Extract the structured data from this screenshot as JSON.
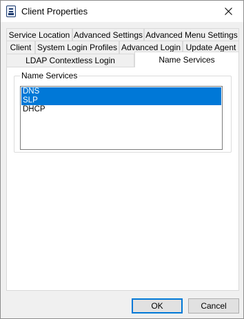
{
  "window": {
    "title": "Client Properties",
    "close_icon": "close-icon",
    "app_icon": "client-properties-icon"
  },
  "tabs": {
    "row1": [
      "Service Location",
      "Advanced Settings",
      "Advanced Menu Settings"
    ],
    "row2": [
      "Client",
      "System Login Profiles",
      "Advanced Login",
      "Update Agent"
    ],
    "row3": [
      "LDAP Contextless Login",
      "Name Services"
    ],
    "selected": "Name Services"
  },
  "name_services": {
    "group_label": "Name Services",
    "items": [
      {
        "label": "DNS",
        "selected": true
      },
      {
        "label": "SLP",
        "selected": true
      },
      {
        "label": "DHCP",
        "selected": false
      }
    ]
  },
  "buttons": {
    "ok": "OK",
    "cancel": "Cancel"
  },
  "colors": {
    "selection": "#0078d7",
    "window_bg": "#f0f0f0",
    "panel_bg": "#ffffff"
  }
}
